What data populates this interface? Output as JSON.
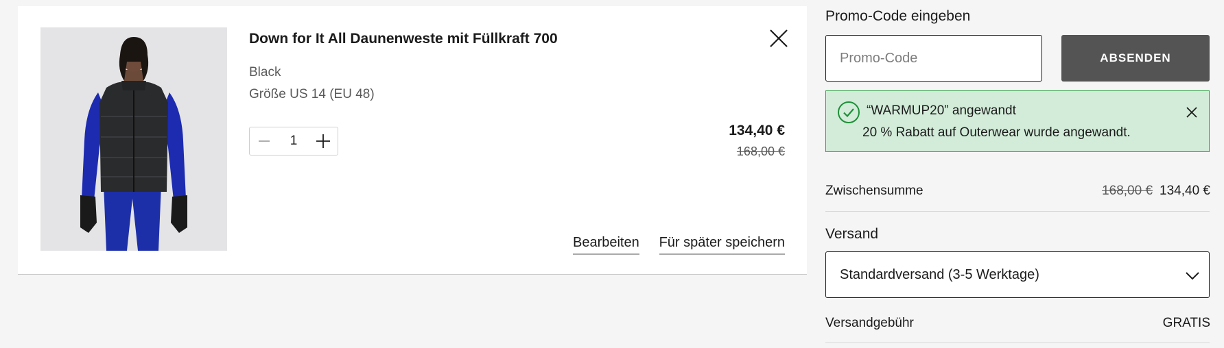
{
  "cart_item": {
    "title": "Down for It All Daunenweste mit Füllkraft 700",
    "color": "Black",
    "size": "Größe US 14 (EU 48)",
    "quantity": "1",
    "price_current": "134,40 €",
    "price_original": "168,00 €",
    "edit_label": "Bearbeiten",
    "save_for_later_label": "Für später speichern",
    "image_icon": "product-photo-vest"
  },
  "promo": {
    "heading": "Promo-Code eingeben",
    "input_placeholder": "Promo-Code",
    "input_value": "",
    "submit_label": "ABSENDEN",
    "applied_code_text": "“WARMUP20” angewandt",
    "applied_message": "20 % Rabatt auf Outerwear wurde angewandt."
  },
  "summary": {
    "subtotal_label": "Zwischensumme",
    "subtotal_original": "168,00 €",
    "subtotal_current": "134,40 €",
    "shipping_heading": "Versand",
    "shipping_selected": "Standardversand (3-5 Werktage)",
    "shipping_fee_label": "Versandgebühr",
    "shipping_fee_value": "GRATIS"
  },
  "colors": {
    "success_bg": "#d3ecd9",
    "success_border": "#31a249",
    "button_dark": "#545454",
    "page_bg": "#f5f5f5"
  },
  "icons": {
    "remove": "close-icon",
    "minus": "minus-icon",
    "plus": "plus-icon",
    "success": "check-circle-icon",
    "dismiss": "close-icon",
    "dropdown": "chevron-down-icon"
  }
}
